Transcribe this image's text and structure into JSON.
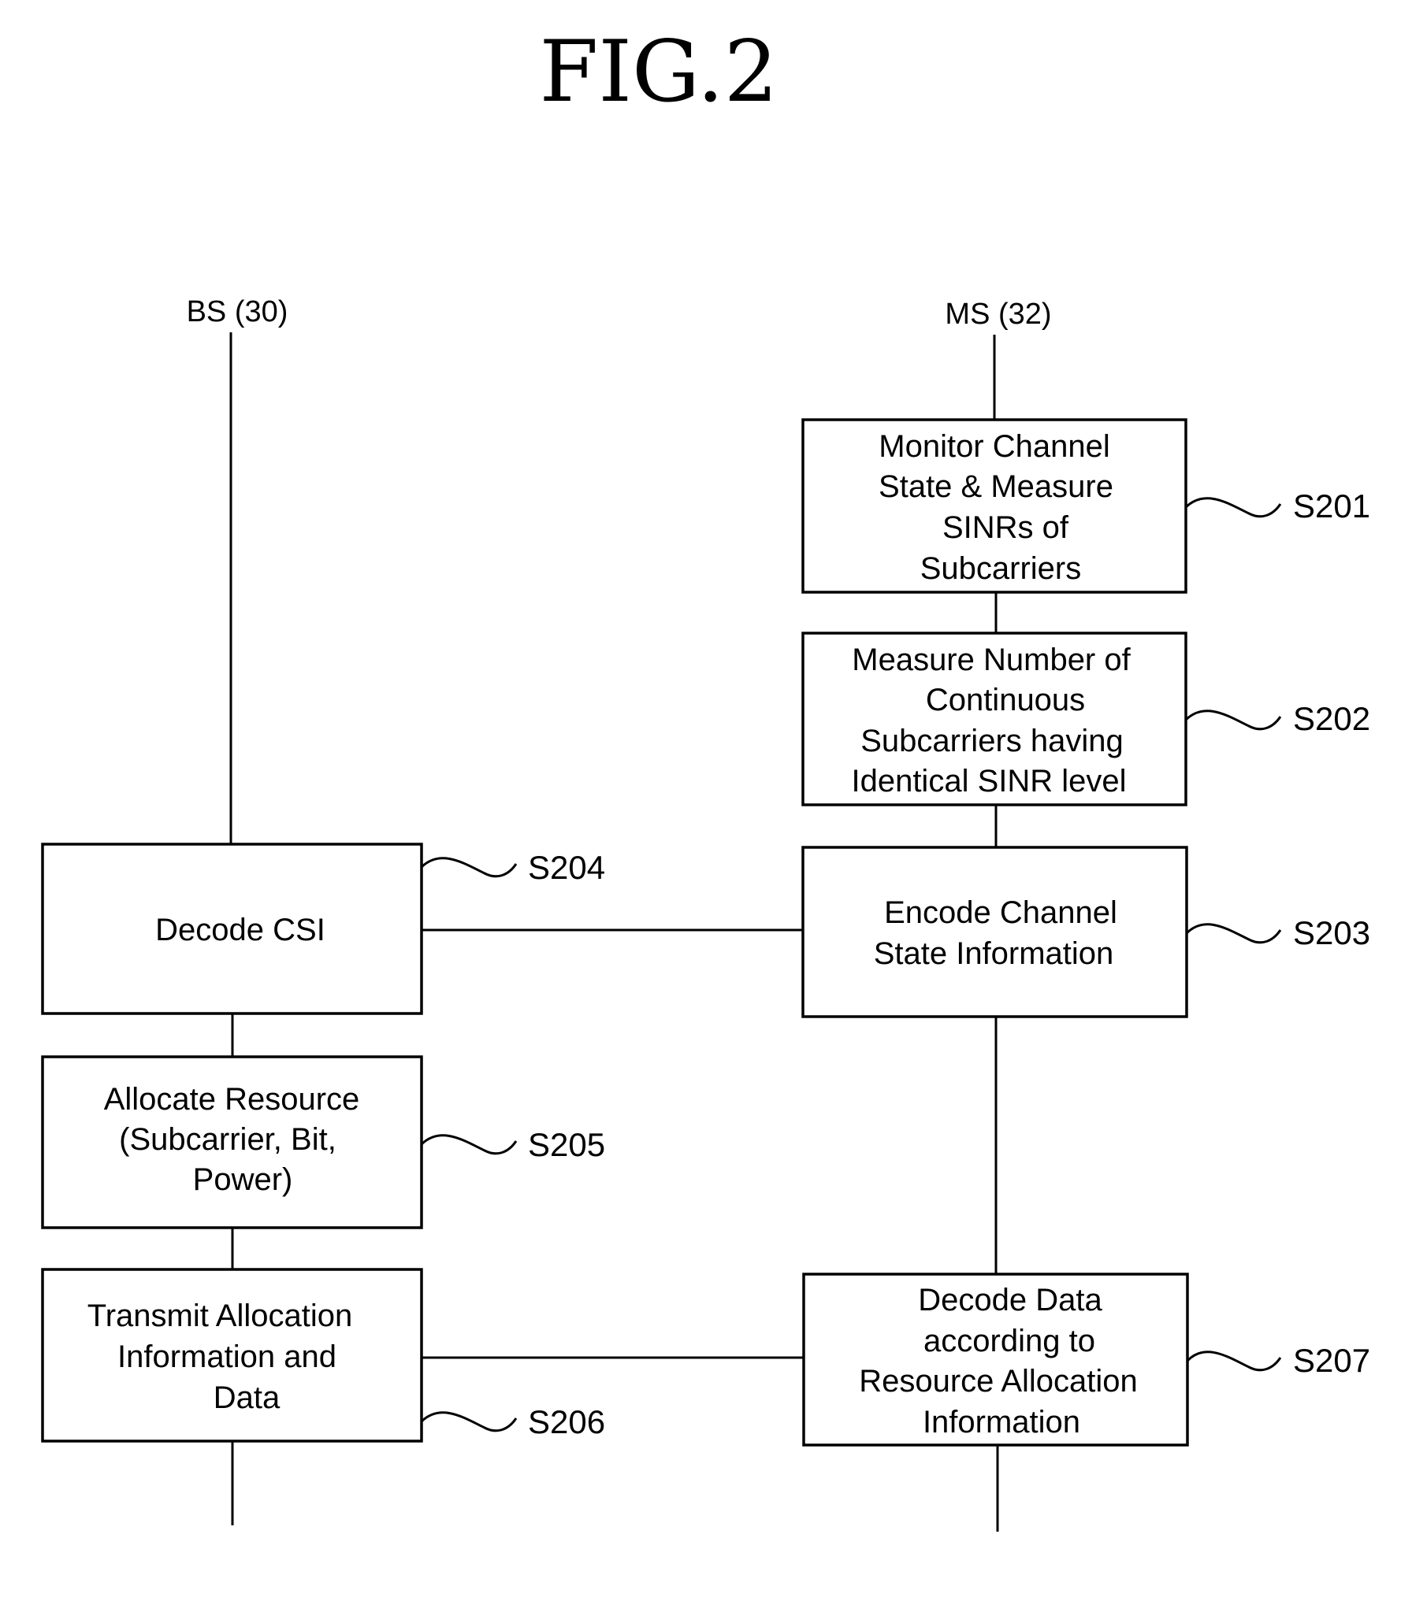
{
  "figure": {
    "title": "FIG.2"
  },
  "lanes": {
    "bs": {
      "label": "BS (30)"
    },
    "ms": {
      "label": "MS (32)"
    }
  },
  "steps": [
    {
      "id": "S201",
      "lane": "ms",
      "label": "S201",
      "lines": [
        "Monitor Channel",
        "State & Measure",
        "SINRs of",
        "Subcarriers"
      ]
    },
    {
      "id": "S202",
      "lane": "ms",
      "label": "S202",
      "lines": [
        "Measure Number of",
        "Continuous",
        "Subcarriers having",
        "Identical SINR level"
      ]
    },
    {
      "id": "S203",
      "lane": "ms",
      "label": "S203",
      "lines": [
        "Encode Channel",
        "State Information"
      ]
    },
    {
      "id": "S204",
      "lane": "bs",
      "label": "S204",
      "lines": [
        "Decode CSI"
      ]
    },
    {
      "id": "S205",
      "lane": "bs",
      "label": "S205",
      "lines": [
        "Allocate Resource",
        "(Subcarrier, Bit,",
        "Power)"
      ]
    },
    {
      "id": "S206",
      "lane": "bs",
      "label": "S206",
      "lines": [
        "Transmit Allocation",
        "Information and",
        "Data"
      ]
    },
    {
      "id": "S207",
      "lane": "ms",
      "label": "S207",
      "lines": [
        "Decode Data",
        "according to",
        "Resource Allocation",
        "Information"
      ]
    }
  ],
  "connections": [
    {
      "from": "S203",
      "to": "S204"
    },
    {
      "from": "S206",
      "to": "S207"
    }
  ]
}
